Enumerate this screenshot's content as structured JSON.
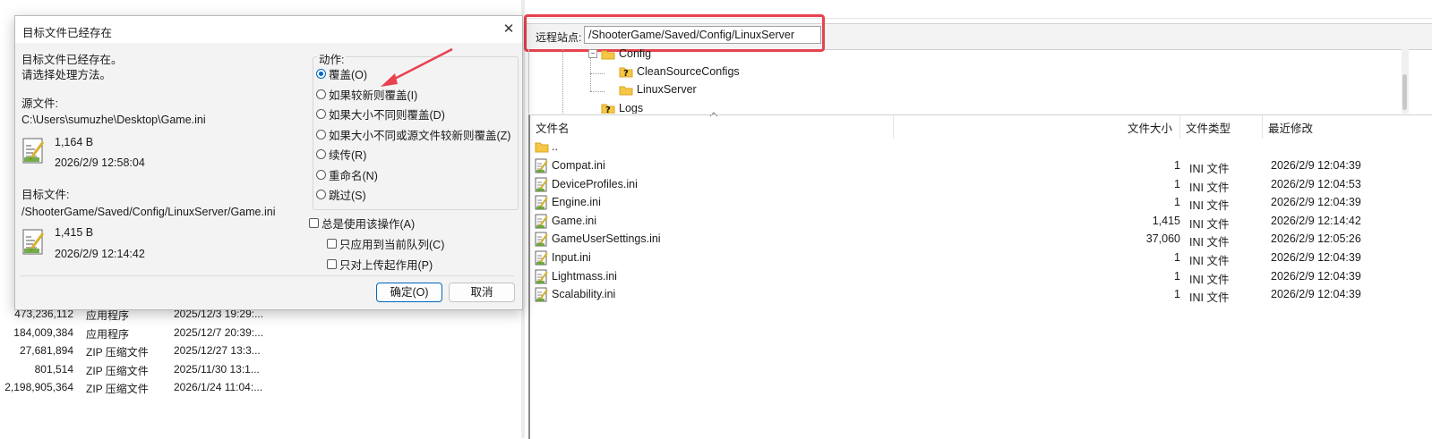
{
  "dialog": {
    "title": "目标文件已经存在",
    "message1": "目标文件已经存在。",
    "message2": "请选择处理方法。",
    "source_label": "源文件:",
    "source_path": "C:\\Users\\sumuzhe\\Desktop\\Game.ini",
    "source_size": "1,164 B",
    "source_date": "2026/2/9 12:58:04",
    "target_label": "目标文件:",
    "target_path": "/ShooterGame/Saved/Config/LinuxServer/Game.ini",
    "target_size": "1,415 B",
    "target_date": "2026/2/9 12:14:42",
    "action_label": "动作:",
    "options": [
      {
        "label": "覆盖(O)",
        "selected": true
      },
      {
        "label": "如果较新则覆盖(I)",
        "selected": false
      },
      {
        "label": "如果大小不同则覆盖(D)",
        "selected": false
      },
      {
        "label": "如果大小不同或源文件较新则覆盖(Z)",
        "selected": false
      },
      {
        "label": "续传(R)",
        "selected": false
      },
      {
        "label": "重命名(N)",
        "selected": false
      },
      {
        "label": "跳过(S)",
        "selected": false
      }
    ],
    "always_use": "总是使用该操作(A)",
    "current_queue": "只应用到当前队列(C)",
    "upload_only": "只对上传起作用(P)",
    "ok": "确定(O)",
    "cancel": "取消"
  },
  "remote": {
    "site_label": "远程站点:",
    "site_path": "/ShooterGame/Saved/Config/LinuxServer",
    "tree": [
      "Config",
      "CleanSourceConfigs",
      "LinuxServer",
      "Logs"
    ],
    "columns": {
      "name": "文件名",
      "size": "文件大小",
      "type": "文件类型",
      "modified": "最近修改"
    },
    "parent": "..",
    "files": [
      {
        "name": "Compat.ini",
        "size": "1",
        "type": "INI 文件",
        "modified": "2026/2/9 12:04:39"
      },
      {
        "name": "DeviceProfiles.ini",
        "size": "1",
        "type": "INI 文件",
        "modified": "2026/2/9 12:04:53"
      },
      {
        "name": "Engine.ini",
        "size": "1",
        "type": "INI 文件",
        "modified": "2026/2/9 12:04:39"
      },
      {
        "name": "Game.ini",
        "size": "1,415",
        "type": "INI 文件",
        "modified": "2026/2/9 12:14:42"
      },
      {
        "name": "GameUserSettings.ini",
        "size": "37,060",
        "type": "INI 文件",
        "modified": "2026/2/9 12:05:26"
      },
      {
        "name": "Input.ini",
        "size": "1",
        "type": "INI 文件",
        "modified": "2026/2/9 12:04:39"
      },
      {
        "name": "Lightmass.ini",
        "size": "1",
        "type": "INI 文件",
        "modified": "2026/2/9 12:04:39"
      },
      {
        "name": "Scalability.ini",
        "size": "1",
        "type": "INI 文件",
        "modified": "2026/2/9 12:04:39"
      }
    ]
  },
  "local": {
    "files": [
      {
        "size": "473,236,112",
        "type": "应用程序",
        "modified": "2025/12/3 19:29:..."
      },
      {
        "size": "184,009,384",
        "type": "应用程序",
        "modified": "2025/12/7 20:39:..."
      },
      {
        "size": "27,681,894",
        "type": "ZIP 压缩文件",
        "modified": "2025/12/27 13:3..."
      },
      {
        "size": "801,514",
        "type": "ZIP 压缩文件",
        "modified": "2025/11/30 13:1..."
      },
      {
        "size": "2,198,905,364",
        "type": "ZIP 压缩文件",
        "modified": "2026/1/24 11:04:..."
      }
    ]
  },
  "colors": {
    "accent": "#0067c0",
    "highlight": "#e8424f",
    "folder": "#f6c744"
  }
}
